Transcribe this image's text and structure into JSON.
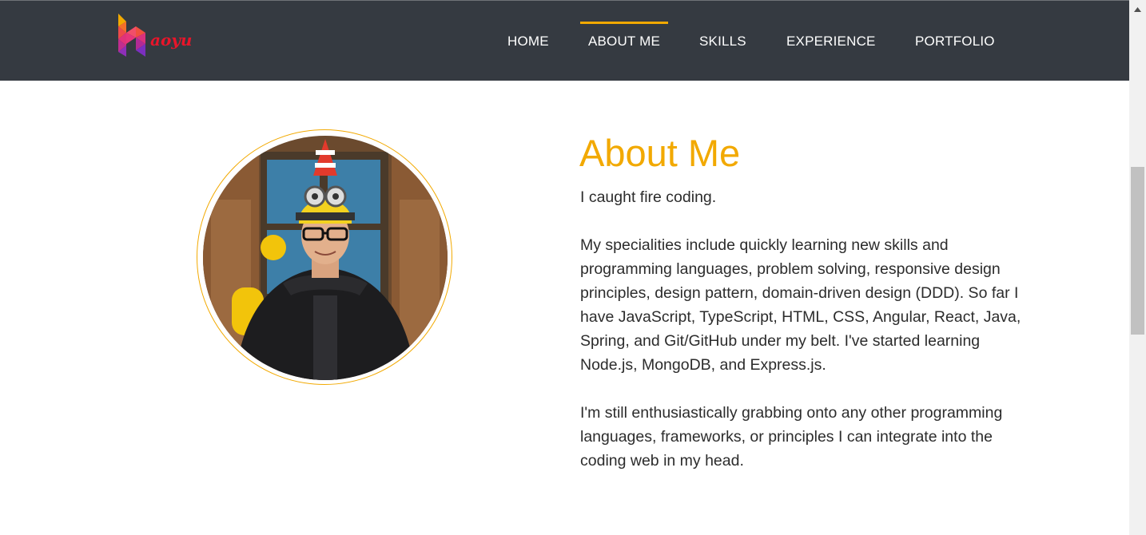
{
  "header": {
    "logo_text": "aoyu",
    "nav": [
      {
        "label": "HOME"
      },
      {
        "label": "ABOUT ME",
        "active": true
      },
      {
        "label": "SKILLS"
      },
      {
        "label": "EXPERIENCE"
      },
      {
        "label": "PORTFOLIO"
      }
    ]
  },
  "about": {
    "title": "About Me",
    "paragraphs": [
      "I caught fire coding.",
      "My specialities include quickly learning new skills and programming languages, problem solving, responsive design principles, design pattern, domain-driven design (DDD). So far I have JavaScript, TypeScript, HTML, CSS, Angular, React, Java, Spring, and Git/GitHub under my belt. I've started learning Node.js, MongoDB, and Express.js.",
      "I'm still enthusiastically grabbing onto any other programming languages, frameworks, or principles I can integrate into the coding web in my head."
    ]
  },
  "colors": {
    "accent": "#f2a900",
    "navbar_bg": "#353a41",
    "text": "#2c2c2c"
  },
  "icons": {
    "scroll_up": "triangle-up-icon"
  }
}
